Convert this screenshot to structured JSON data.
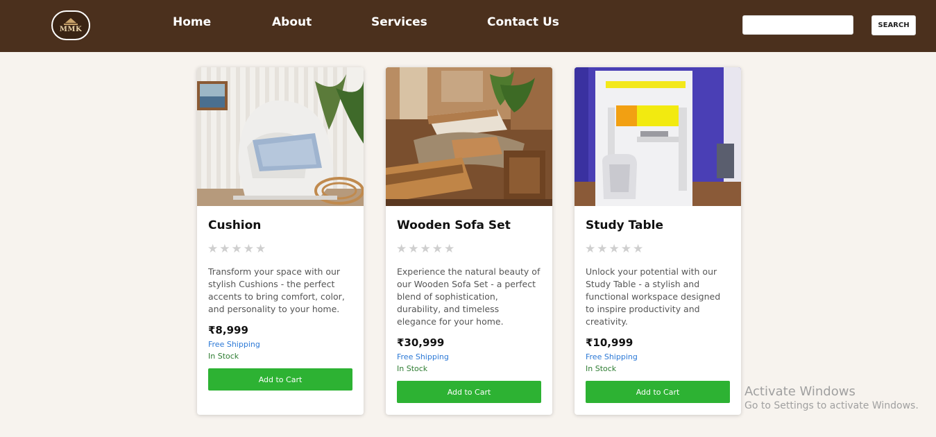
{
  "nav": {
    "logo_text": "MMK",
    "links": [
      "Home",
      "About",
      "Services",
      "Contact Us"
    ],
    "search_placeholder": "",
    "search_button": "SEARCH"
  },
  "products": [
    {
      "title": "Cushion",
      "rating": 0,
      "description": "Transform your space with our stylish Cushions - the perfect accents to bring comfort, color, and personality to your home.",
      "price": "₹8,999",
      "shipping": "Free Shipping",
      "stock": "In Stock",
      "button": "Add to Cart"
    },
    {
      "title": "Wooden Sofa Set",
      "rating": 0,
      "description": "Experience the natural beauty of our Wooden Sofa Set - a perfect blend of sophistication, durability, and timeless elegance for your home.",
      "price": "₹30,999",
      "shipping": "Free Shipping",
      "stock": "In Stock",
      "button": "Add to Cart"
    },
    {
      "title": "Study Table",
      "rating": 0,
      "description": "Unlock your potential with our Study Table - a stylish and functional workspace designed to inspire productivity and creativity.",
      "price": "₹10,999",
      "shipping": "Free Shipping",
      "stock": "In Stock",
      "button": "Add to Cart"
    }
  ],
  "watermark": {
    "title": "Activate Windows",
    "subtitle": "Go to Settings to activate Windows."
  },
  "colors": {
    "nav_bg": "#4b301d",
    "page_bg": "#f7f3ee",
    "cart_button": "#2db233",
    "shipping_text": "#2b78d6",
    "stock_text": "#2e7d32"
  }
}
